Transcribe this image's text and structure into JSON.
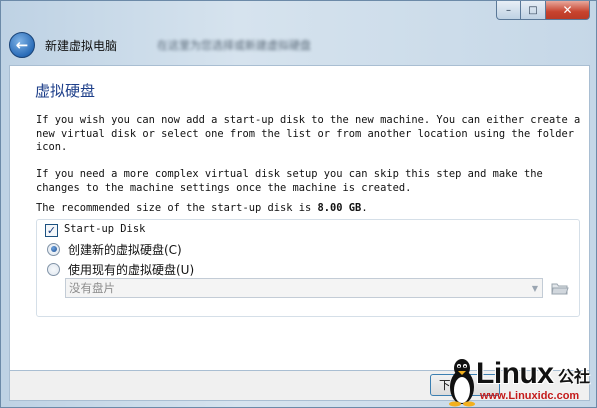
{
  "window": {
    "caption_buttons": {
      "minimize_glyph": "–",
      "maximize_glyph": "□",
      "close_glyph": "✕"
    }
  },
  "nav": {
    "back_glyph": "←",
    "title": "新建虚拟电脑",
    "obscured_caption": "在这里为您选择或新建虚拟硬盘"
  },
  "page": {
    "heading": "虚拟硬盘",
    "para1": "If you wish you can now add a start-up disk to the new machine. You can either create a new virtual disk or select one from the list or from another location using the folder icon.",
    "para2": "If you need a more complex virtual disk setup you can skip this step and make the changes to the machine settings once the machine is created.",
    "recommended_prefix": "The recommended size of the start-up disk is ",
    "recommended_size": "8.00 GB",
    "recommended_suffix": "."
  },
  "startup_disk": {
    "checkbox_label": "Start-up Disk",
    "checked": true,
    "check_glyph": "✓",
    "option_create": "创建新的虚拟硬盘(C)",
    "option_existing": "使用现有的虚拟硬盘(U)",
    "selected_option": "create",
    "combo_value": "没有盘片",
    "combo_arrow": "▼"
  },
  "buttons": {
    "next_label": "下一步"
  },
  "watermark": {
    "brand": "Linux",
    "brand_cn": "公社",
    "url": "www.Linuxidc.com"
  },
  "colors": {
    "heading": "#1e3f8a",
    "accent_blue": "#2a6cb8",
    "close_red": "#c7432e",
    "watermark_url": "#c41a1a"
  }
}
